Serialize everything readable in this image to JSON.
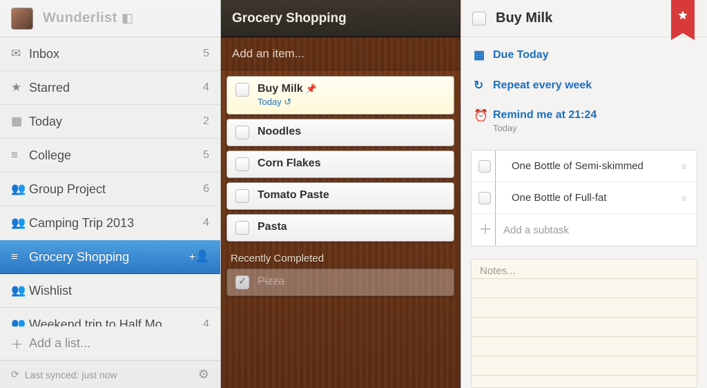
{
  "brand": "Wunderlist",
  "sidebar": {
    "items": [
      {
        "icon": "inbox-icon",
        "glyph": "✉",
        "label": "Inbox",
        "count": "5",
        "selected": false
      },
      {
        "icon": "star-icon",
        "glyph": "★",
        "label": "Starred",
        "count": "4",
        "selected": false
      },
      {
        "icon": "calendar-icon",
        "glyph": "▦",
        "label": "Today",
        "count": "2",
        "selected": false
      },
      {
        "icon": "list-icon",
        "glyph": "≡",
        "label": "College",
        "count": "5",
        "selected": false
      },
      {
        "icon": "people-icon",
        "glyph": "👥",
        "label": "Group Project",
        "count": "6",
        "selected": false
      },
      {
        "icon": "people-icon",
        "glyph": "👥",
        "label": "Camping Trip 2013",
        "count": "4",
        "selected": false
      },
      {
        "icon": "list-icon",
        "glyph": "≡",
        "label": "Grocery Shopping",
        "count": "+👤",
        "selected": true
      },
      {
        "icon": "people-icon",
        "glyph": "👥",
        "label": "Wishlist",
        "count": "",
        "selected": false
      },
      {
        "icon": "people-icon",
        "glyph": "👥",
        "label": "Weekend trip to Half Mo...",
        "count": "4",
        "selected": false
      }
    ],
    "addLabel": "Add a list...",
    "syncLabel": "Last synced: just now"
  },
  "list": {
    "title": "Grocery Shopping",
    "addPlaceholder": "Add an item...",
    "tasks": [
      {
        "title": "Buy Milk",
        "sub": "Today ↺",
        "pinned": true,
        "selected": true
      },
      {
        "title": "Noodles",
        "sub": "",
        "pinned": false,
        "selected": false
      },
      {
        "title": "Corn Flakes",
        "sub": "",
        "pinned": false,
        "selected": false
      },
      {
        "title": "Tomato Paste",
        "sub": "",
        "pinned": false,
        "selected": false
      },
      {
        "title": "Pasta",
        "sub": "",
        "pinned": false,
        "selected": false
      }
    ],
    "completedHeader": "Recently Completed",
    "completed": [
      {
        "title": "Pizza"
      }
    ]
  },
  "detail": {
    "title": "Buy Milk",
    "due": {
      "glyph": "▦",
      "label": "Due Today"
    },
    "repeat": {
      "glyph": "↻",
      "label": "Repeat every week"
    },
    "remind": {
      "glyph": "⏰",
      "label": "Remind me at 21:24",
      "sub": "Today"
    },
    "subtasks": [
      {
        "title": "One Bottle of Semi-skimmed"
      },
      {
        "title": "One Bottle of Full-fat"
      }
    ],
    "addSubtask": "Add a subtask",
    "notesPlaceholder": "Notes..."
  }
}
